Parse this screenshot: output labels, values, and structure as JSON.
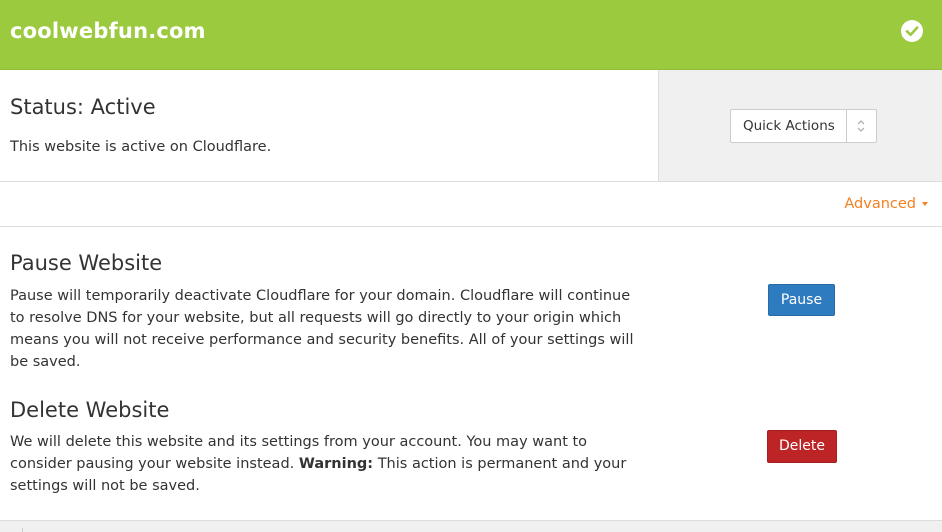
{
  "header": {
    "domain": "coolwebfun.com",
    "status_icon": "check-circle-icon",
    "accent_color": "#9bca3e"
  },
  "status": {
    "title": "Status: Active",
    "description": "This website is active on Cloudflare.",
    "quick_actions_label": "Quick Actions"
  },
  "advanced": {
    "label": "Advanced",
    "color": "#f38020"
  },
  "pause_section": {
    "title": "Pause Website",
    "description": "Pause will temporarily deactivate Cloudflare for your domain. Cloudflare will continue to resolve DNS for your website, but all requests will go directly to your origin which means you will not receive performance and security benefits. All of your settings will be saved.",
    "button_label": "Pause",
    "button_color": "#2f7bbf"
  },
  "delete_section": {
    "title": "Delete Website",
    "description_before": "We will delete this website and its settings from your account. You may want to consider pausing your website instead. ",
    "warning_label": "Warning:",
    "description_after": " This action is permanent and your settings will not be saved.",
    "button_label": "Delete",
    "button_color": "#bd2426"
  }
}
